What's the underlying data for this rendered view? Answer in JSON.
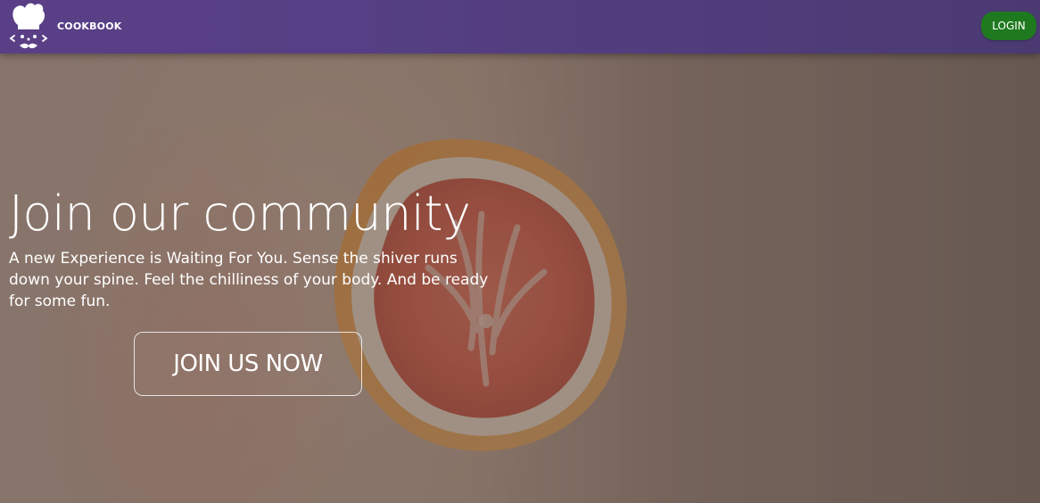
{
  "nav": {
    "brand_name": "COOKBOOK",
    "login_label": "LOGIN",
    "colors": {
      "bar": "#553f83",
      "login_bg": "#1f7a1f"
    }
  },
  "hero": {
    "title": "Join our community",
    "subtitle": "A new Experience is Waiting For You. Sense the shiver runs down your spine. Feel the chilliness of your body. And be ready for some fun.",
    "cta_label": "JOIN US NOW"
  },
  "icons": {
    "logo": "chef-hat-face-icon"
  }
}
